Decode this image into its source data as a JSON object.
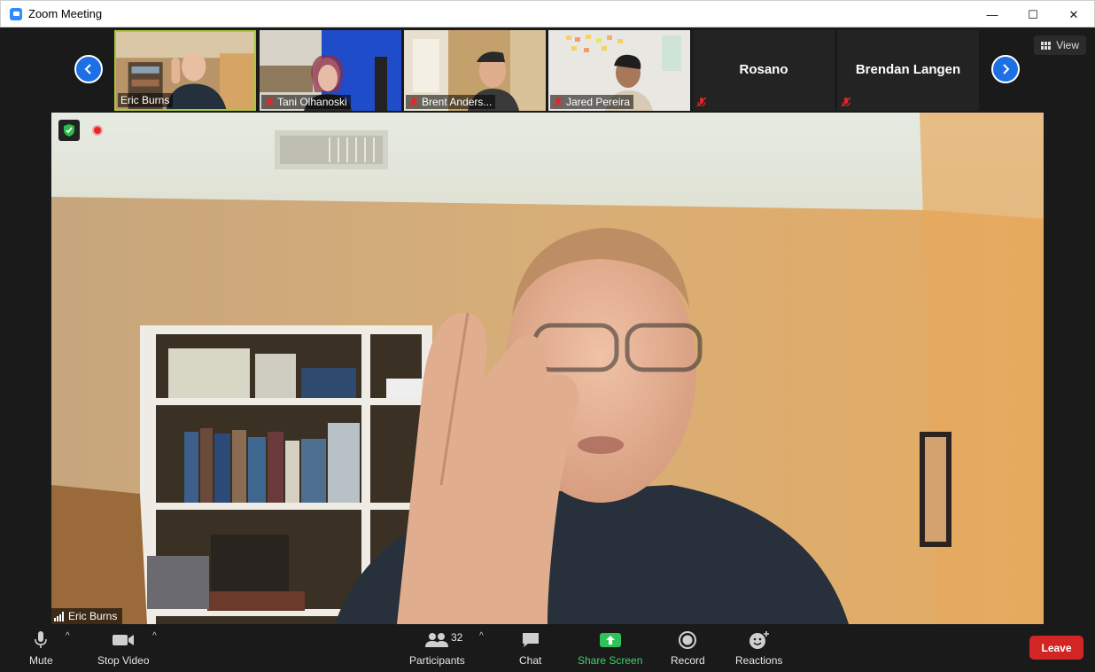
{
  "window": {
    "title": "Zoom Meeting",
    "minimize_glyph": "—",
    "maximize_glyph": "☐",
    "close_glyph": "✕"
  },
  "view_button": {
    "label": "View"
  },
  "thumbnails": [
    {
      "name": "Eric Burns",
      "muted": false,
      "active": true
    },
    {
      "name": "Tani Olhanoski",
      "muted": true
    },
    {
      "name": "Brent Anders...",
      "muted": true
    },
    {
      "name": "Jared Pereira",
      "muted": true
    },
    {
      "name": "Rosano",
      "muted": true,
      "video": false
    },
    {
      "name": "Brendan Langen",
      "muted": true,
      "video": false
    }
  ],
  "main_video": {
    "speaker_name": "Eric Burns",
    "recording_label": "Recording..."
  },
  "toolbar": {
    "mute_label": "Mute",
    "stop_video_label": "Stop Video",
    "participants_label": "Participants",
    "participants_count": "32",
    "chat_label": "Chat",
    "share_screen_label": "Share Screen",
    "record_label": "Record",
    "reactions_label": "Reactions",
    "leave_label": "Leave",
    "caret_glyph": "^"
  },
  "colors": {
    "accent_blue": "#1d6fe6",
    "share_green": "#3fd16b",
    "leave_red": "#d42525",
    "active_speaker_border": "#a6c83a"
  }
}
